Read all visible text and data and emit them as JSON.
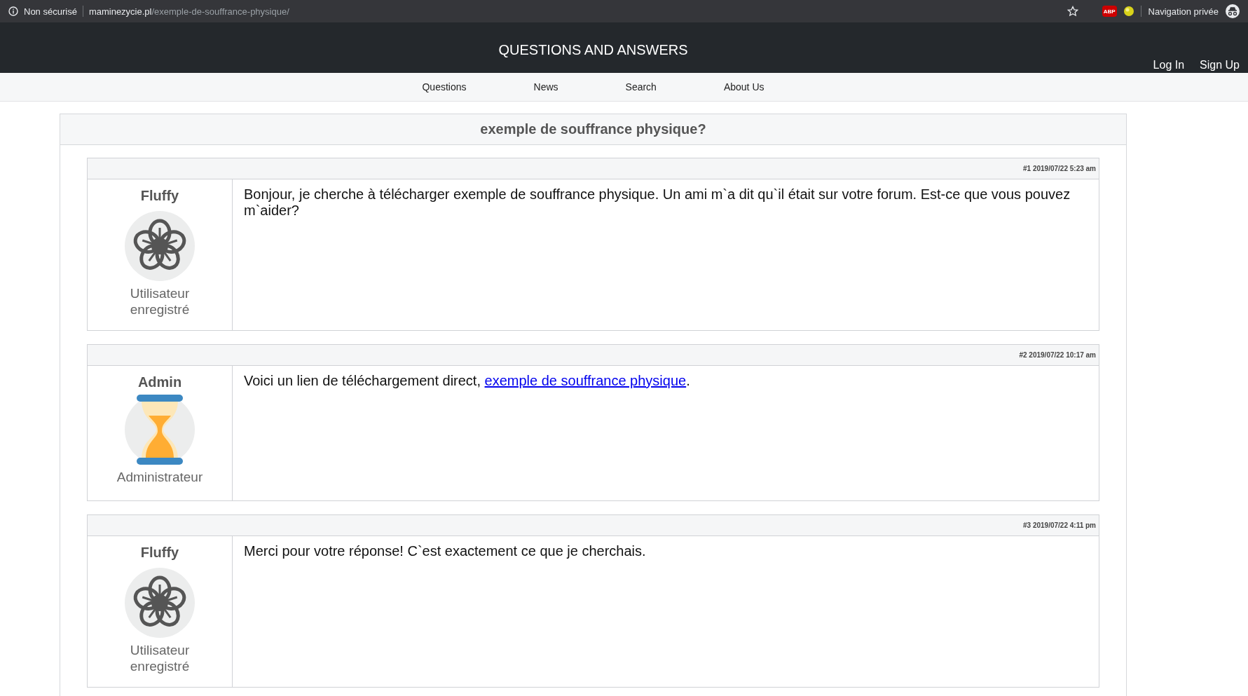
{
  "browser": {
    "security": "Non sécurisé",
    "domain": "maminezycie.pl",
    "path": "/exemple-de-souffrance-physique/",
    "adblock": "ABP",
    "profile": "Navigation privée"
  },
  "header": {
    "title": "QUESTIONS AND ANSWERS",
    "auth_links": [
      "Log In",
      "Sign Up"
    ]
  },
  "nav": [
    "Questions",
    "News",
    "Search",
    "About Us"
  ],
  "topic": {
    "title": "exemple de souffrance physique?"
  },
  "posts": [
    {
      "meta": "#1 2019/07/22 5:23 am",
      "author": "Fluffy",
      "avatar": {
        "kind": "flower"
      },
      "role": "Utilisateur enregistré",
      "body": [
        {
          "kind": "text",
          "text": "Bonjour, je cherche à télécharger exemple de souffrance physique. Un ami m`a dit qu`il était sur votre forum. Est-ce que vous pouvez m`aider?"
        }
      ]
    },
    {
      "meta": "#2 2019/07/22 10:17 am",
      "author": "Admin",
      "avatar": {
        "kind": "hourglass"
      },
      "role": "Administrateur",
      "body": [
        {
          "kind": "text",
          "text": "Voici un lien de téléchargement direct, "
        },
        {
          "kind": "link",
          "text": "exemple de souffrance physique"
        },
        {
          "kind": "text",
          "text": "."
        }
      ]
    },
    {
      "meta": "#3 2019/07/22 4:11 pm",
      "author": "Fluffy",
      "avatar": {
        "kind": "flower"
      },
      "role": "Utilisateur enregistré",
      "body": [
        {
          "kind": "text",
          "text": "Merci pour votre réponse! C`est exactement ce que je cherchais."
        }
      ]
    }
  ]
}
